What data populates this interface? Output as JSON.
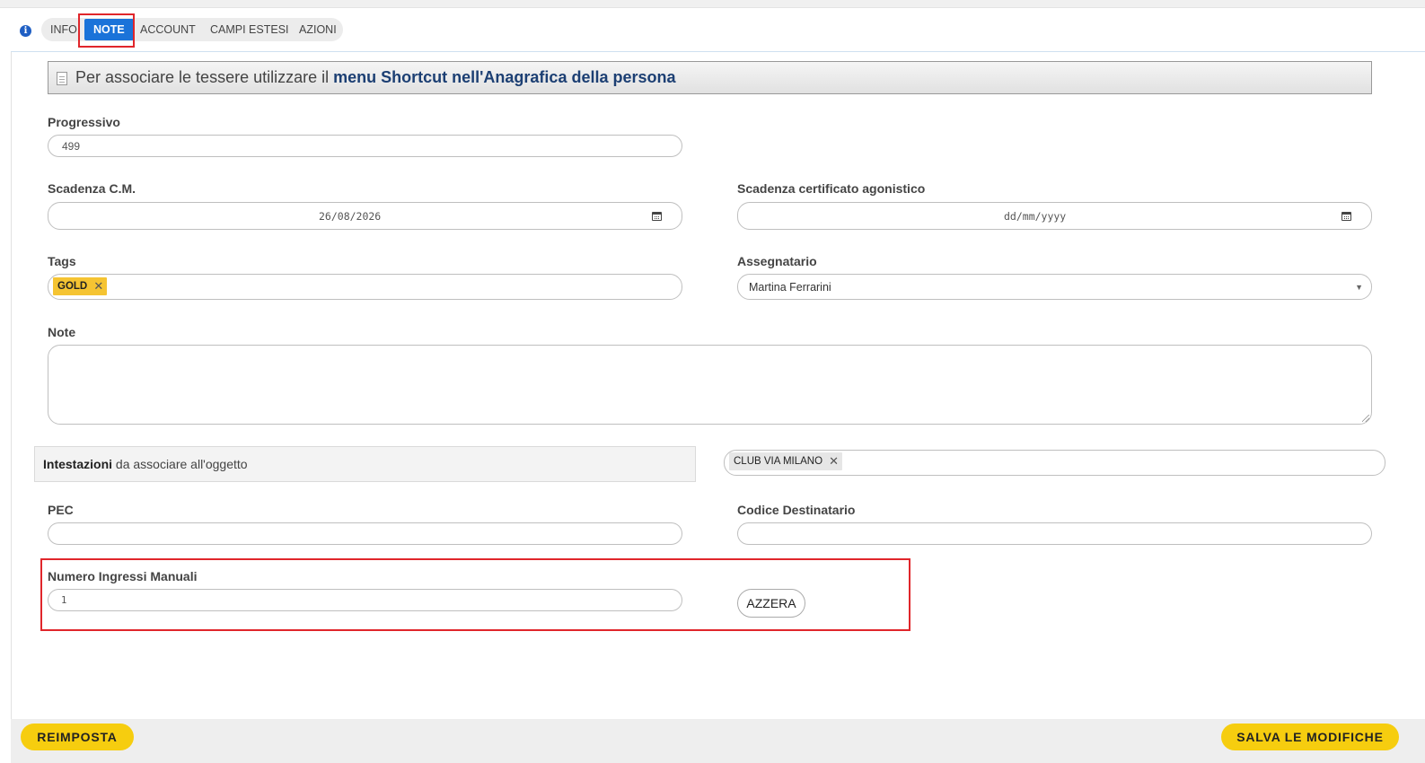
{
  "tabs": [
    {
      "label": "INFO",
      "active": false
    },
    {
      "label": "NOTE",
      "active": true
    },
    {
      "label": "ACCOUNT",
      "active": false
    },
    {
      "label": "CAMPI ESTESI",
      "active": false
    },
    {
      "label": "AZIONI",
      "active": false
    }
  ],
  "banner": {
    "text": "Per associare le tessere utilizzare il ",
    "highlight": "menu Shortcut nell'Anagrafica della persona"
  },
  "form": {
    "progressivo": {
      "label": "Progressivo",
      "value": "499"
    },
    "scadenza_cm": {
      "label": "Scadenza C.M.",
      "value": "26/08/2026"
    },
    "scadenza_cert": {
      "label": "Scadenza certificato agonistico",
      "placeholder": "dd/mm/yyyy"
    },
    "tags": {
      "label": "Tags",
      "items": [
        "GOLD"
      ]
    },
    "assegnatario": {
      "label": "Assegnatario",
      "value": "Martina Ferrarini"
    },
    "note": {
      "label": "Note",
      "value": ""
    },
    "intestazioni": {
      "bold": "Intestazioni",
      "rest": " da associare all'oggetto",
      "items": [
        "CLUB VIA MILANO"
      ]
    },
    "pec": {
      "label": "PEC",
      "value": ""
    },
    "codice_destinatario": {
      "label": "Codice Destinatario",
      "value": ""
    },
    "ingressi": {
      "label": "Numero Ingressi Manuali",
      "value": "1"
    },
    "azzera_label": "AZZERA"
  },
  "footer": {
    "reset_label": "REIMPOSTA",
    "save_label": "SALVA LE MODIFICHE"
  },
  "colors": {
    "accent": "#1a73d9",
    "highlight_box": "#e0262b",
    "button_yellow": "#f6cd0f",
    "tag_gold": "#f5c432"
  }
}
